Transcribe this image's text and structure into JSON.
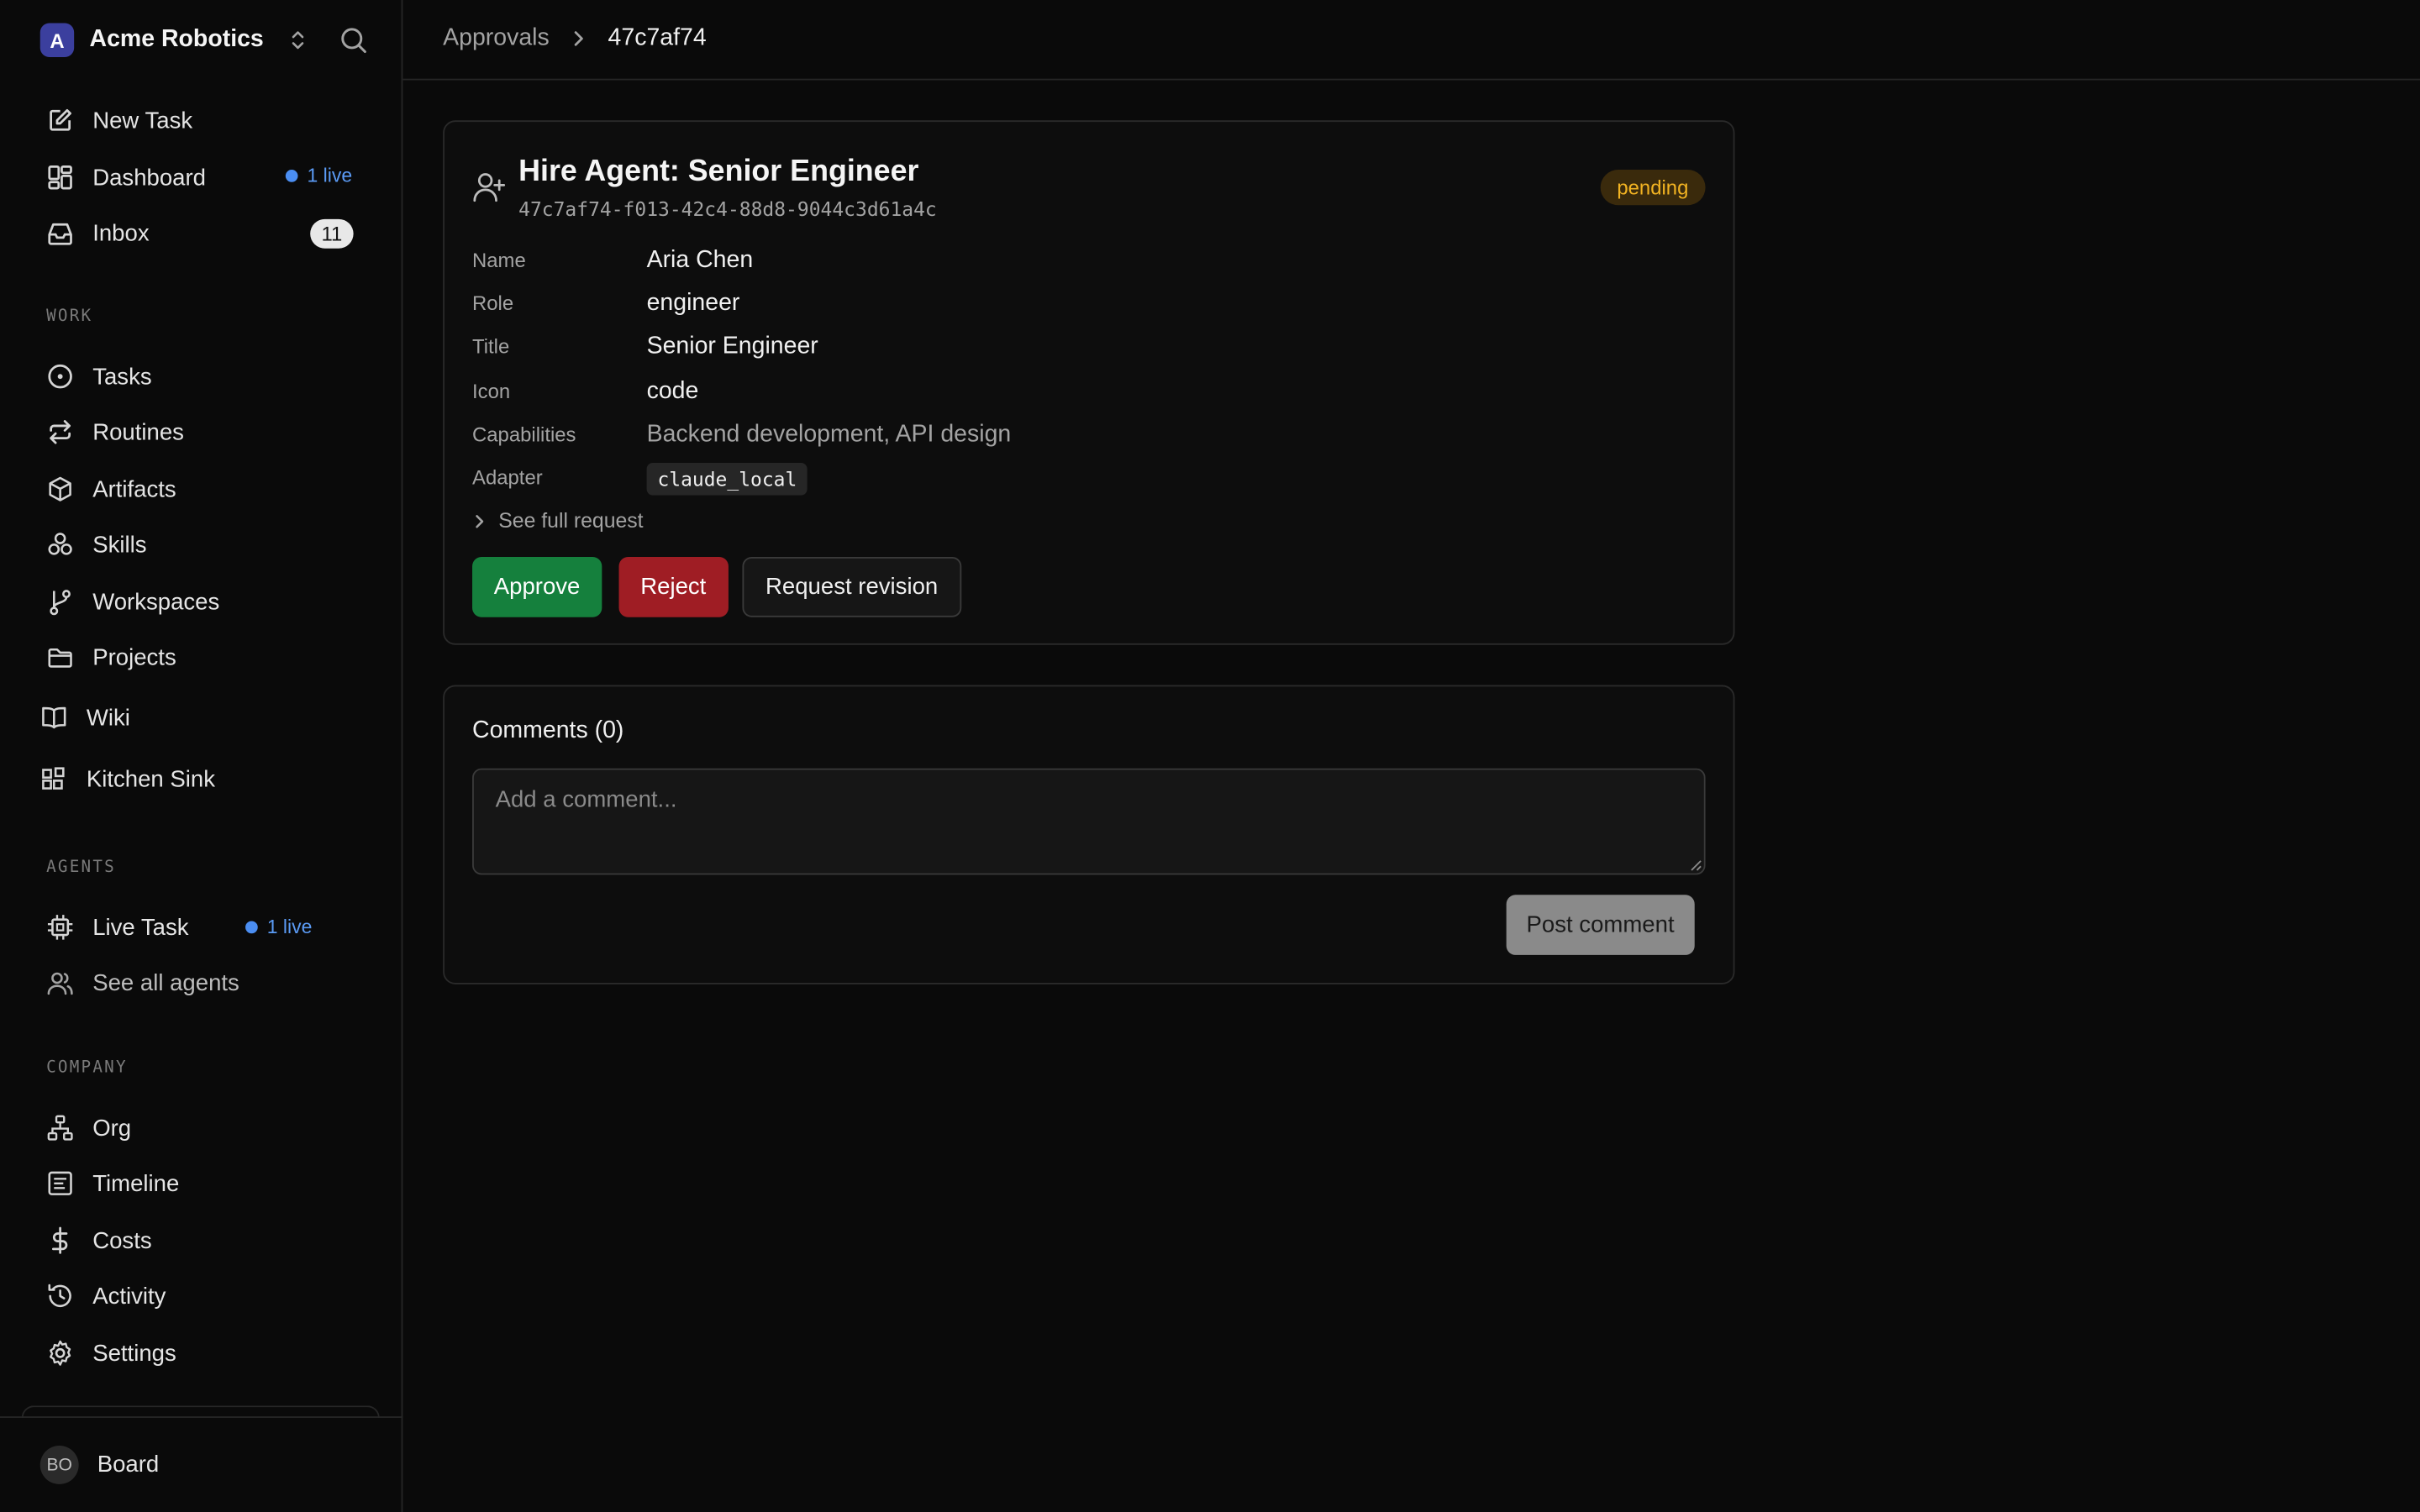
{
  "brand": {
    "initial": "A",
    "name": "Acme Robotics"
  },
  "nav_top": [
    {
      "label": "New Task",
      "icon": "edit-icon"
    },
    {
      "label": "Dashboard",
      "icon": "dashboard-icon",
      "live": "1 live"
    },
    {
      "label": "Inbox",
      "icon": "inbox-icon",
      "count": "11"
    }
  ],
  "sections": {
    "work": "WORK",
    "agents": "AGENTS",
    "company": "COMPANY"
  },
  "nav_work": [
    {
      "label": "Tasks",
      "icon": "circle-dot-icon"
    },
    {
      "label": "Routines",
      "icon": "repeat-icon"
    },
    {
      "label": "Artifacts",
      "icon": "box-icon"
    },
    {
      "label": "Skills",
      "icon": "boxes-icon"
    },
    {
      "label": "Workspaces",
      "icon": "git-branch-icon"
    },
    {
      "label": "Projects",
      "icon": "folder-icon"
    },
    {
      "label": "Wiki",
      "icon": "book-icon"
    },
    {
      "label": "Kitchen Sink",
      "icon": "blocks-icon"
    }
  ],
  "nav_agents": [
    {
      "label": "Live Task",
      "icon": "cpu-icon",
      "live": "1 live"
    },
    {
      "label": "See all agents",
      "icon": "users-icon"
    }
  ],
  "nav_company": [
    {
      "label": "Org",
      "icon": "org-chart-icon"
    },
    {
      "label": "Timeline",
      "icon": "timeline-icon"
    },
    {
      "label": "Costs",
      "icon": "dollar-icon"
    },
    {
      "label": "Activity",
      "icon": "history-icon"
    },
    {
      "label": "Settings",
      "icon": "gear-icon"
    }
  ],
  "footer_user": {
    "initials": "BO",
    "label": "Board"
  },
  "breadcrumb": {
    "parent": "Approvals",
    "current": "47c7af74"
  },
  "approval": {
    "title": "Hire Agent: Senior Engineer",
    "id": "47c7af74-f013-42c4-88d8-9044c3d61a4c",
    "status": "pending",
    "fields": {
      "name_label": "Name",
      "name": "Aria Chen",
      "role_label": "Role",
      "role": "engineer",
      "title_label": "Title",
      "title": "Senior Engineer",
      "icon_label": "Icon",
      "icon": "code",
      "capabilities_label": "Capabilities",
      "capabilities": "Backend development, API design",
      "adapter_label": "Adapter",
      "adapter": "claude_local"
    },
    "see_full": "See full request",
    "actions": {
      "approve": "Approve",
      "reject": "Reject",
      "revise": "Request revision"
    }
  },
  "comments": {
    "title": "Comments (0)",
    "placeholder": "Add a comment...",
    "post": "Post comment"
  },
  "colors": {
    "background": "#0a0a0a",
    "approve": "#15803d",
    "reject": "#9f1d24",
    "pending_text": "#f2b322",
    "live_dot": "#4b8ef2"
  }
}
